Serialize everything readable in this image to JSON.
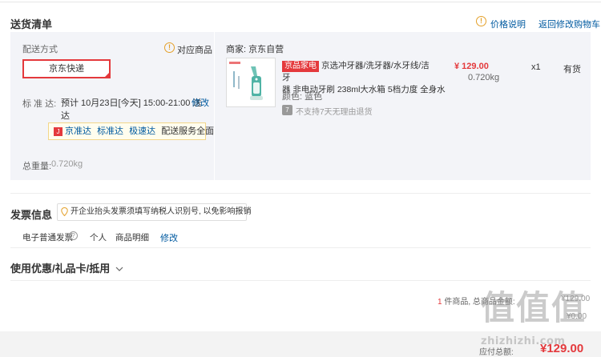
{
  "delivery": {
    "title": "送货清单",
    "price_note": "价格说明",
    "back_to_cart": "返回修改购物车",
    "method_label": "配送方式",
    "match_goods": "对应商品",
    "method_value": "京东快递",
    "standard_label": "标 准 达:",
    "standard_time_line1": "预计 10月23日[今天] 15:00-21:00 送",
    "standard_time_line2": "达",
    "modify": "修改",
    "tip_items": [
      "京准达",
      "标准达",
      "极速达"
    ],
    "tip_text": "配送服务全面升级",
    "total_weight_label": "总重量:",
    "total_weight_value": "0.720kg"
  },
  "product": {
    "seller_label": "商家: 京东自营",
    "tag": "京品家电",
    "name_line1": "京选冲牙器/洗牙器/水牙线/洁牙",
    "name_line2": "器 非电动牙刷 238ml大水箱 5档力度 全身水",
    "price": "¥ 129.00",
    "weight": "0.720kg",
    "qty": "x1",
    "stock": "有货",
    "color_label": "颜色: 蓝色",
    "return_badge": "7",
    "return_note": "不支持7天无理由退货"
  },
  "invoice": {
    "title": "发票信息",
    "tip": "开企业抬头发票须填写纳税人识别号, 以免影响报销",
    "type": "电子普通发票",
    "holder": "个人",
    "content": "商品明细",
    "modify": "修改"
  },
  "discount": {
    "title": "使用优惠/礼品卡/抵用"
  },
  "summary": {
    "count": "1",
    "count_text": "件商品, 总商品金额:",
    "total_value": "¥129.00",
    "freight_value": "¥0.00",
    "payable_label": "应付总额:",
    "payable_value": "¥129.00"
  },
  "watermark": {
    "text": "zhizhizhi.com",
    "glyphs": "值值值"
  },
  "colors": {
    "accent_red": "#e4393c",
    "link_blue": "#005aa0",
    "panel_bg": "#f3f4f8",
    "warn_orange": "#e4a029"
  }
}
